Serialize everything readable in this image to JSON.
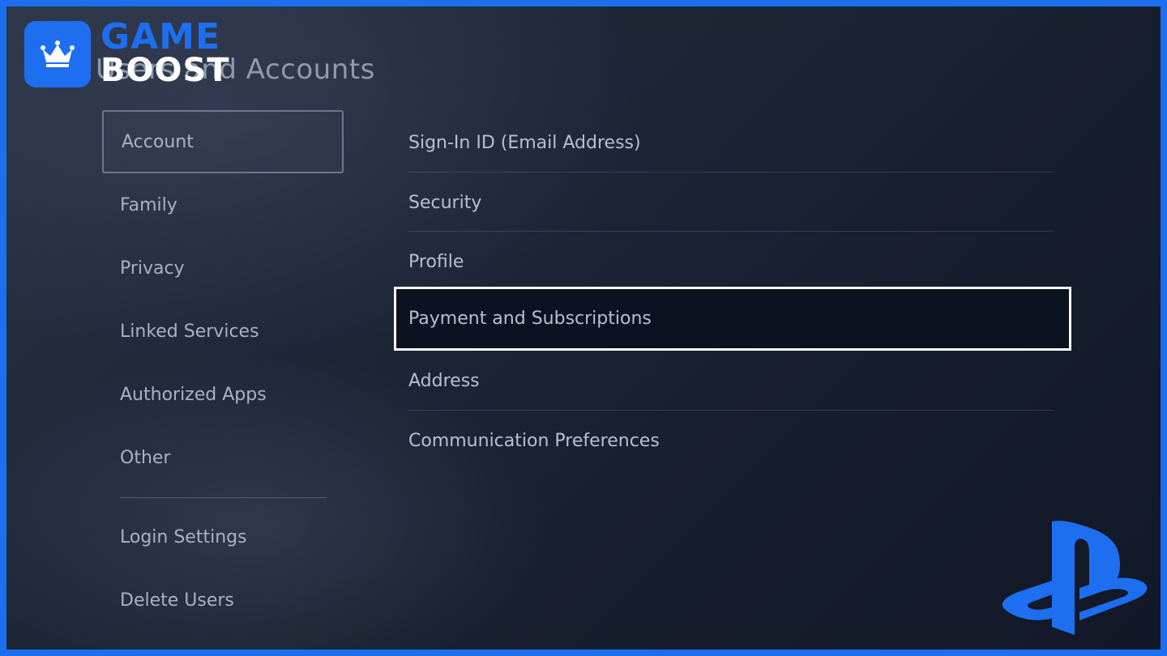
{
  "header": {
    "title": "Users and Accounts"
  },
  "watermark": {
    "word1": "GAME",
    "word2": "BOOST",
    "icon": "crown-icon",
    "color": "#1d6ff0"
  },
  "sidebar": {
    "items": [
      {
        "label": "Account",
        "selected": true
      },
      {
        "label": "Family"
      },
      {
        "label": "Privacy"
      },
      {
        "label": "Linked Services"
      },
      {
        "label": "Authorized Apps"
      },
      {
        "label": "Other"
      },
      {
        "label": "Login Settings"
      },
      {
        "label": "Delete Users"
      }
    ]
  },
  "main": {
    "items": [
      {
        "label": "Sign-In ID (Email Address)"
      },
      {
        "label": "Security"
      },
      {
        "label": "Profile"
      },
      {
        "label": "Payment and Subscriptions",
        "focused": true
      },
      {
        "label": "Address"
      },
      {
        "label": "Communication Preferences"
      }
    ]
  },
  "brand": {
    "logo": "playstation-logo-icon",
    "color": "#1d6ff0"
  }
}
